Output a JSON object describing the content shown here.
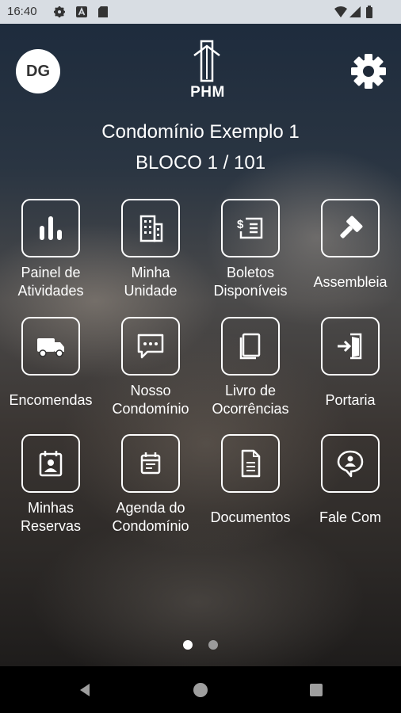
{
  "status_bar": {
    "time": "16:40"
  },
  "header": {
    "avatar_initials": "DG",
    "logo_text": "PHM",
    "condo_name": "Condomínio Exemplo 1",
    "unit": "BLOCO 1 / 101"
  },
  "menu": {
    "items": [
      {
        "label_line1": "Painel de",
        "label_line2": "Atividades",
        "icon": "bar-chart-icon"
      },
      {
        "label_line1": "Minha",
        "label_line2": "Unidade",
        "icon": "building-icon"
      },
      {
        "label_line1": "Boletos",
        "label_line2": "Disponíveis",
        "icon": "bill-icon"
      },
      {
        "label_line1": "Assembleia",
        "label_line2": "",
        "icon": "gavel-icon"
      },
      {
        "label_line1": "Encomendas",
        "label_line2": "",
        "icon": "delivery-truck-icon"
      },
      {
        "label_line1": "Nosso",
        "label_line2": "Condomínio",
        "icon": "chat-bubble-icon"
      },
      {
        "label_line1": "Livro de",
        "label_line2": "Ocorrências",
        "icon": "book-icon"
      },
      {
        "label_line1": "Portaria",
        "label_line2": "",
        "icon": "door-enter-icon"
      },
      {
        "label_line1": "Minhas",
        "label_line2": "Reservas",
        "icon": "calendar-person-icon"
      },
      {
        "label_line1": "Agenda do",
        "label_line2": "Condomínio",
        "icon": "calendar-icon"
      },
      {
        "label_line1": "Documentos",
        "label_line2": "",
        "icon": "document-icon"
      },
      {
        "label_line1": "Fale Com",
        "label_line2": "",
        "icon": "contact-chat-icon"
      }
    ]
  },
  "pager": {
    "pages": 2,
    "current": 1
  },
  "colors": {
    "accent": "#ffffff",
    "status_bar": "#d8dde3",
    "nav_bar": "#000000"
  }
}
